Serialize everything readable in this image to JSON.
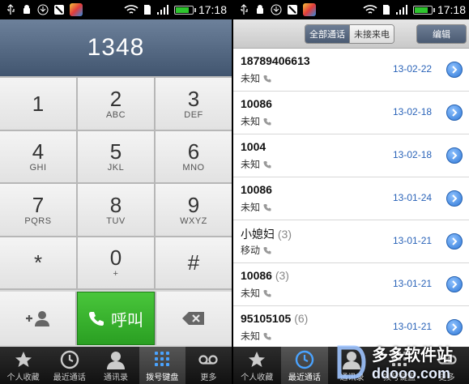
{
  "status": {
    "time": "17:18"
  },
  "dialer": {
    "entered_number": "1348",
    "keys": [
      {
        "digit": "1",
        "letters": ""
      },
      {
        "digit": "2",
        "letters": "ABC"
      },
      {
        "digit": "3",
        "letters": "DEF"
      },
      {
        "digit": "4",
        "letters": "GHI"
      },
      {
        "digit": "5",
        "letters": "JKL"
      },
      {
        "digit": "6",
        "letters": "MNO"
      },
      {
        "digit": "7",
        "letters": "PQRS"
      },
      {
        "digit": "8",
        "letters": "TUV"
      },
      {
        "digit": "9",
        "letters": "WXYZ"
      },
      {
        "digit": "*",
        "letters": ""
      },
      {
        "digit": "0",
        "letters": "+"
      },
      {
        "digit": "#",
        "letters": ""
      }
    ],
    "call_label": "呼叫"
  },
  "left_nav": [
    {
      "label": "个人收藏",
      "icon": "star-icon"
    },
    {
      "label": "最近通话",
      "icon": "clock-icon"
    },
    {
      "label": "通讯录",
      "icon": "contact-icon"
    },
    {
      "label": "拨号键盘",
      "icon": "keypad-icon",
      "active": true
    },
    {
      "label": "更多",
      "icon": "voicemail-icon"
    }
  ],
  "recents": {
    "filter_all": "全部通话",
    "filter_missed": "未接来电",
    "edit_label": "编辑",
    "items": [
      {
        "number": "18789406613",
        "count": "",
        "label": "未知",
        "date": "13-02-22"
      },
      {
        "number": "10086",
        "count": "",
        "label": "未知",
        "date": "13-02-18"
      },
      {
        "number": "1004",
        "count": "",
        "label": "未知",
        "date": "13-02-18"
      },
      {
        "number": "10086",
        "count": "",
        "label": "未知",
        "date": "13-01-24"
      },
      {
        "number": "小媳妇",
        "count": "(3)",
        "label": "移动",
        "date": "13-01-21"
      },
      {
        "number": "10086",
        "count": "(3)",
        "label": "未知",
        "date": "13-01-21"
      },
      {
        "number": "95105105",
        "count": "(6)",
        "label": "未知",
        "date": "13-01-21"
      }
    ]
  },
  "right_nav": [
    {
      "label": "个人收藏",
      "icon": "star-icon"
    },
    {
      "label": "最近通话",
      "icon": "clock-icon",
      "active": true
    },
    {
      "label": "通讯录",
      "icon": "contact-icon"
    },
    {
      "label": "拨号键盘",
      "icon": "keypad-icon"
    },
    {
      "label": "更多",
      "icon": "voicemail-icon"
    }
  ],
  "watermark": {
    "text_cn": "多多软件站",
    "text_en": "ddooo.com"
  },
  "colors": {
    "call_green": "#2a9f22",
    "accent_blue": "#2a63b8",
    "display_blue": "#4f6380"
  }
}
